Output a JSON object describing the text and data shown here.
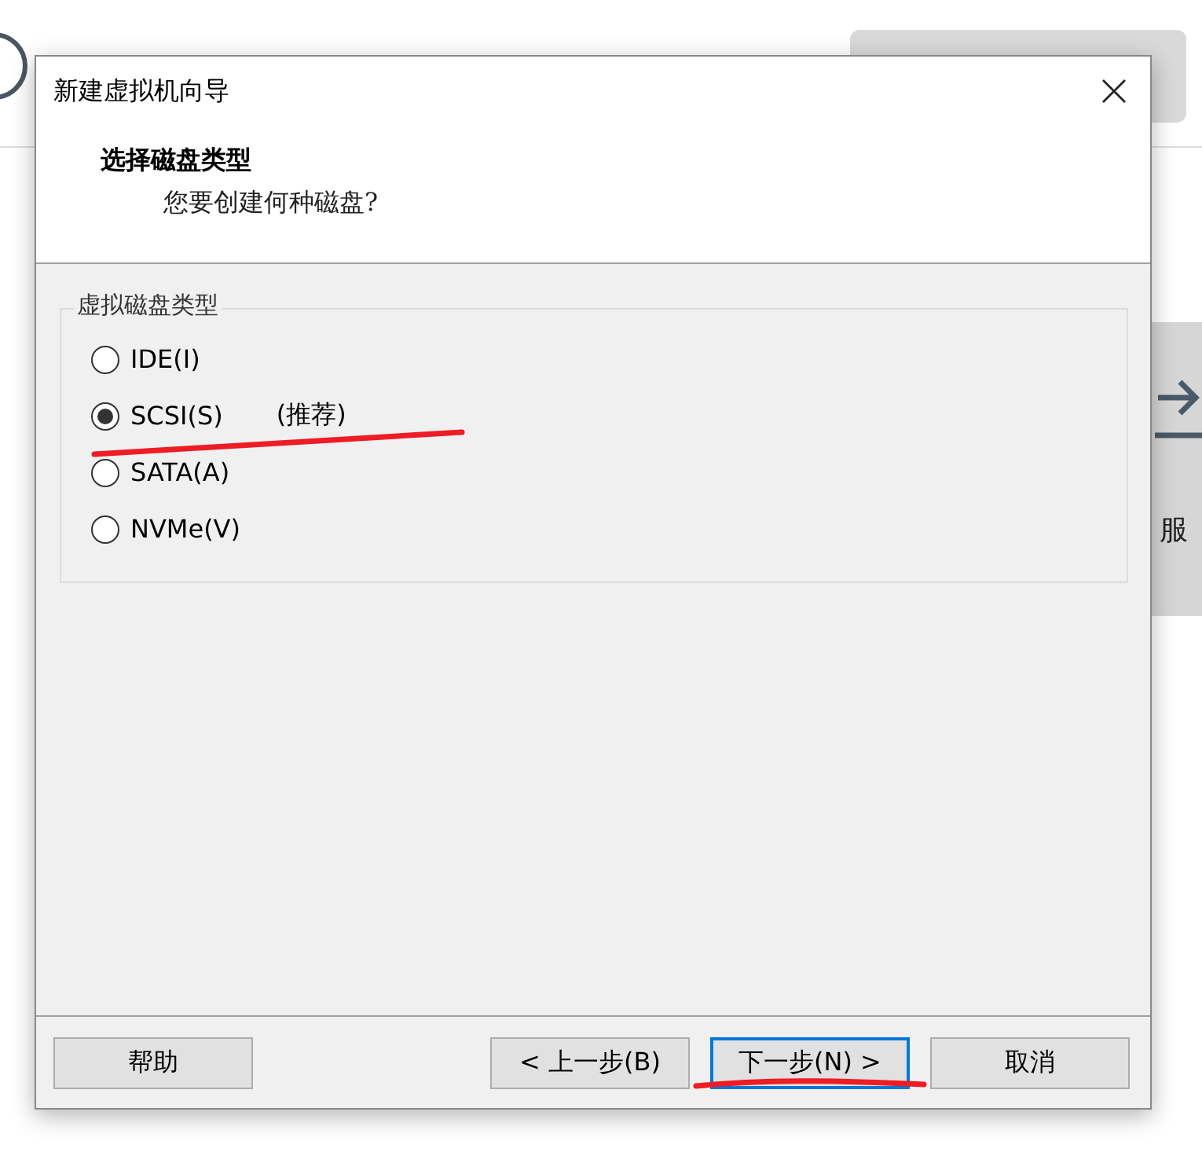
{
  "background": {
    "side_panel_text": "服"
  },
  "window": {
    "title": "新建虚拟机向导"
  },
  "header": {
    "title": "选择磁盘类型",
    "subtitle": "您要创建何种磁盘?"
  },
  "group": {
    "label": "虚拟磁盘类型",
    "options": [
      {
        "label": "IDE(I)",
        "selected": false
      },
      {
        "label": "SCSI(S)",
        "selected": true,
        "note": "(推荐)"
      },
      {
        "label": "SATA(A)",
        "selected": false
      },
      {
        "label": "NVMe(V)",
        "selected": false
      }
    ]
  },
  "buttons": [
    {
      "label": "帮助",
      "focused": false
    },
    {
      "label": "< 上一步(B)",
      "focused": false
    },
    {
      "label": "下一步(N) >",
      "focused": true
    },
    {
      "label": "取消",
      "focused": false
    }
  ],
  "annotations": [
    {
      "kind": "pen-stroke"
    },
    {
      "kind": "pen-stroke"
    }
  ]
}
